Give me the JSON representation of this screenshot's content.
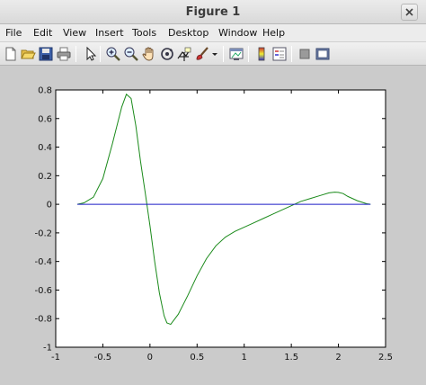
{
  "window": {
    "title": "Figure 1",
    "close_glyph": "✕"
  },
  "menu": {
    "items": [
      "File",
      "Edit",
      "View",
      "Insert",
      "Tools",
      "Desktop",
      "Window",
      "Help"
    ]
  },
  "toolbar": {
    "buttons": [
      "new-figure-icon",
      "open-file-icon",
      "save-icon",
      "print-icon",
      "pointer-icon",
      "zoom-in-icon",
      "zoom-out-icon",
      "pan-hand-icon",
      "rotate-3d-icon",
      "data-cursor-icon",
      "brush-icon",
      "dropdown-arrow-icon",
      "link-plot-icon",
      "colorbar-icon",
      "legend-icon",
      "hide-plot-tools-icon",
      "show-plot-tools-icon"
    ]
  },
  "colors": {
    "series_green": "#1a8a1a",
    "series_blue": "#1c1cc8",
    "axes_bg": "#ffffff",
    "figure_bg": "#cbcbcb"
  },
  "chart_data": {
    "type": "line",
    "xlim": [
      -1,
      2.5
    ],
    "ylim": [
      -1,
      0.8
    ],
    "xticks": [
      -1,
      -0.5,
      0,
      0.5,
      1,
      1.5,
      2,
      2.5
    ],
    "xtick_labels": [
      "-1",
      "-0.5",
      "0",
      "0.5",
      "1",
      "1.5",
      "2",
      "2.5"
    ],
    "yticks": [
      -1,
      -0.8,
      -0.6,
      -0.4,
      -0.2,
      0,
      0.2,
      0.4,
      0.6,
      0.8
    ],
    "ytick_labels": [
      "-1",
      "-0.8",
      "-0.6",
      "-0.4",
      "-0.2",
      "0",
      "0.2",
      "0.4",
      "0.6",
      "0.8"
    ],
    "grid": false,
    "series": [
      {
        "color": "#1a8a1a",
        "x": [
          -0.77,
          -0.7,
          -0.6,
          -0.5,
          -0.4,
          -0.3,
          -0.25,
          -0.2,
          -0.15,
          -0.1,
          -0.05,
          0.0,
          0.05,
          0.1,
          0.15,
          0.18,
          0.22,
          0.3,
          0.4,
          0.5,
          0.6,
          0.7,
          0.8,
          0.9,
          1.0,
          1.1,
          1.2,
          1.3,
          1.4,
          1.5,
          1.6,
          1.7,
          1.8,
          1.9,
          1.96,
          2.0,
          2.05,
          2.1,
          2.2,
          2.3,
          2.34
        ],
        "y": [
          0.0,
          0.01,
          0.05,
          0.18,
          0.42,
          0.68,
          0.77,
          0.74,
          0.55,
          0.3,
          0.08,
          -0.15,
          -0.4,
          -0.62,
          -0.78,
          -0.83,
          -0.84,
          -0.77,
          -0.64,
          -0.5,
          -0.38,
          -0.29,
          -0.23,
          -0.19,
          -0.16,
          -0.13,
          -0.1,
          -0.07,
          -0.04,
          -0.01,
          0.02,
          0.04,
          0.06,
          0.08,
          0.085,
          0.083,
          0.075,
          0.055,
          0.025,
          0.004,
          0.0
        ]
      },
      {
        "color": "#1c1cc8",
        "x": [
          -0.77,
          2.34
        ],
        "y": [
          0.0,
          0.0
        ]
      }
    ]
  }
}
